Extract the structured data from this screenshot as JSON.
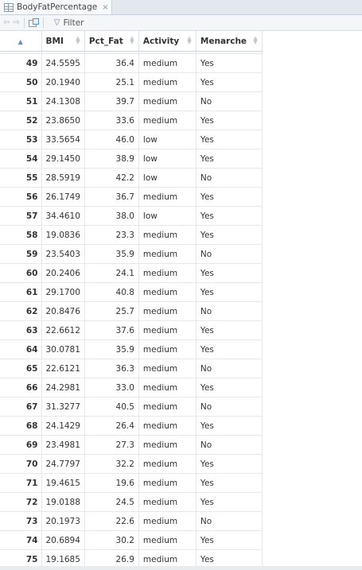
{
  "tab": {
    "title": "BodyFatPercentage",
    "close_glyph": "×"
  },
  "toolbar": {
    "back_glyph": "⇦",
    "forward_glyph": "⇨",
    "filter_label": "Filter"
  },
  "columns": [
    {
      "label": "",
      "sorted": "asc"
    },
    {
      "label": "BMI"
    },
    {
      "label": "Pct_Fat"
    },
    {
      "label": "Activity"
    },
    {
      "label": "Menarche"
    }
  ],
  "rows": [
    [
      "49",
      "24.5595",
      "36.4",
      "medium",
      "Yes"
    ],
    [
      "50",
      "20.1940",
      "25.1",
      "medium",
      "Yes"
    ],
    [
      "51",
      "24.1308",
      "39.7",
      "medium",
      "No"
    ],
    [
      "52",
      "23.8650",
      "33.6",
      "medium",
      "Yes"
    ],
    [
      "53",
      "33.5654",
      "46.0",
      "low",
      "Yes"
    ],
    [
      "54",
      "29.1450",
      "38.9",
      "low",
      "Yes"
    ],
    [
      "55",
      "28.5919",
      "42.2",
      "low",
      "No"
    ],
    [
      "56",
      "26.1749",
      "36.7",
      "medium",
      "Yes"
    ],
    [
      "57",
      "34.4610",
      "38.0",
      "low",
      "Yes"
    ],
    [
      "58",
      "19.0836",
      "23.3",
      "medium",
      "Yes"
    ],
    [
      "59",
      "23.5403",
      "35.9",
      "medium",
      "No"
    ],
    [
      "60",
      "20.2406",
      "24.1",
      "medium",
      "Yes"
    ],
    [
      "61",
      "29.1700",
      "40.8",
      "medium",
      "Yes"
    ],
    [
      "62",
      "20.8476",
      "25.7",
      "medium",
      "No"
    ],
    [
      "63",
      "22.6612",
      "37.6",
      "medium",
      "Yes"
    ],
    [
      "64",
      "30.0781",
      "35.9",
      "medium",
      "Yes"
    ],
    [
      "65",
      "22.6121",
      "36.3",
      "medium",
      "No"
    ],
    [
      "66",
      "24.2981",
      "33.0",
      "medium",
      "Yes"
    ],
    [
      "67",
      "31.3277",
      "40.5",
      "medium",
      "No"
    ],
    [
      "68",
      "24.1429",
      "26.4",
      "medium",
      "Yes"
    ],
    [
      "69",
      "23.4981",
      "27.3",
      "medium",
      "No"
    ],
    [
      "70",
      "24.7797",
      "32.2",
      "medium",
      "Yes"
    ],
    [
      "71",
      "19.4615",
      "19.6",
      "medium",
      "Yes"
    ],
    [
      "72",
      "19.0188",
      "24.5",
      "medium",
      "Yes"
    ],
    [
      "73",
      "20.1973",
      "22.6",
      "medium",
      "No"
    ],
    [
      "74",
      "20.6894",
      "30.2",
      "medium",
      "Yes"
    ],
    [
      "75",
      "19.1685",
      "26.9",
      "medium",
      "Yes"
    ]
  ]
}
